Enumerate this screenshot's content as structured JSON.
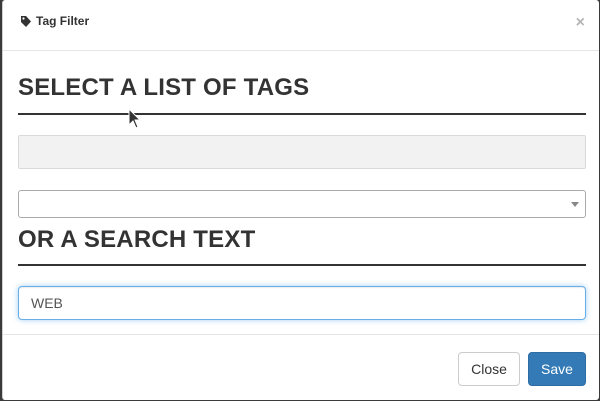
{
  "dialog": {
    "title": "Tag Filter",
    "title_icon": "tag-icon",
    "close_glyph": "×"
  },
  "tags_section": {
    "heading": "SELECT A LIST OF TAGS",
    "select_value": ""
  },
  "search_section": {
    "heading": "OR A SEARCH TEXT",
    "input_value": "WEB"
  },
  "footer": {
    "close_label": "Close",
    "save_label": "Save"
  },
  "colors": {
    "primary": "#337ab7",
    "focus_border": "#66afe9",
    "heading": "#333333"
  }
}
